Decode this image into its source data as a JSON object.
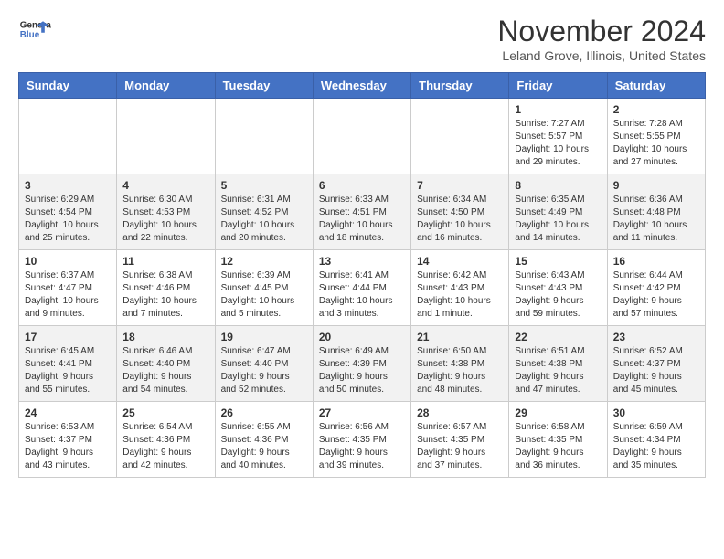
{
  "header": {
    "logo_line1": "General",
    "logo_line2": "Blue",
    "month_title": "November 2024",
    "location": "Leland Grove, Illinois, United States"
  },
  "days_of_week": [
    "Sunday",
    "Monday",
    "Tuesday",
    "Wednesday",
    "Thursday",
    "Friday",
    "Saturday"
  ],
  "weeks": [
    [
      {
        "day": "",
        "info": ""
      },
      {
        "day": "",
        "info": ""
      },
      {
        "day": "",
        "info": ""
      },
      {
        "day": "",
        "info": ""
      },
      {
        "day": "",
        "info": ""
      },
      {
        "day": "1",
        "info": "Sunrise: 7:27 AM\nSunset: 5:57 PM\nDaylight: 10 hours and 29 minutes."
      },
      {
        "day": "2",
        "info": "Sunrise: 7:28 AM\nSunset: 5:55 PM\nDaylight: 10 hours and 27 minutes."
      }
    ],
    [
      {
        "day": "3",
        "info": "Sunrise: 6:29 AM\nSunset: 4:54 PM\nDaylight: 10 hours and 25 minutes."
      },
      {
        "day": "4",
        "info": "Sunrise: 6:30 AM\nSunset: 4:53 PM\nDaylight: 10 hours and 22 minutes."
      },
      {
        "day": "5",
        "info": "Sunrise: 6:31 AM\nSunset: 4:52 PM\nDaylight: 10 hours and 20 minutes."
      },
      {
        "day": "6",
        "info": "Sunrise: 6:33 AM\nSunset: 4:51 PM\nDaylight: 10 hours and 18 minutes."
      },
      {
        "day": "7",
        "info": "Sunrise: 6:34 AM\nSunset: 4:50 PM\nDaylight: 10 hours and 16 minutes."
      },
      {
        "day": "8",
        "info": "Sunrise: 6:35 AM\nSunset: 4:49 PM\nDaylight: 10 hours and 14 minutes."
      },
      {
        "day": "9",
        "info": "Sunrise: 6:36 AM\nSunset: 4:48 PM\nDaylight: 10 hours and 11 minutes."
      }
    ],
    [
      {
        "day": "10",
        "info": "Sunrise: 6:37 AM\nSunset: 4:47 PM\nDaylight: 10 hours and 9 minutes."
      },
      {
        "day": "11",
        "info": "Sunrise: 6:38 AM\nSunset: 4:46 PM\nDaylight: 10 hours and 7 minutes."
      },
      {
        "day": "12",
        "info": "Sunrise: 6:39 AM\nSunset: 4:45 PM\nDaylight: 10 hours and 5 minutes."
      },
      {
        "day": "13",
        "info": "Sunrise: 6:41 AM\nSunset: 4:44 PM\nDaylight: 10 hours and 3 minutes."
      },
      {
        "day": "14",
        "info": "Sunrise: 6:42 AM\nSunset: 4:43 PM\nDaylight: 10 hours and 1 minute."
      },
      {
        "day": "15",
        "info": "Sunrise: 6:43 AM\nSunset: 4:43 PM\nDaylight: 9 hours and 59 minutes."
      },
      {
        "day": "16",
        "info": "Sunrise: 6:44 AM\nSunset: 4:42 PM\nDaylight: 9 hours and 57 minutes."
      }
    ],
    [
      {
        "day": "17",
        "info": "Sunrise: 6:45 AM\nSunset: 4:41 PM\nDaylight: 9 hours and 55 minutes."
      },
      {
        "day": "18",
        "info": "Sunrise: 6:46 AM\nSunset: 4:40 PM\nDaylight: 9 hours and 54 minutes."
      },
      {
        "day": "19",
        "info": "Sunrise: 6:47 AM\nSunset: 4:40 PM\nDaylight: 9 hours and 52 minutes."
      },
      {
        "day": "20",
        "info": "Sunrise: 6:49 AM\nSunset: 4:39 PM\nDaylight: 9 hours and 50 minutes."
      },
      {
        "day": "21",
        "info": "Sunrise: 6:50 AM\nSunset: 4:38 PM\nDaylight: 9 hours and 48 minutes."
      },
      {
        "day": "22",
        "info": "Sunrise: 6:51 AM\nSunset: 4:38 PM\nDaylight: 9 hours and 47 minutes."
      },
      {
        "day": "23",
        "info": "Sunrise: 6:52 AM\nSunset: 4:37 PM\nDaylight: 9 hours and 45 minutes."
      }
    ],
    [
      {
        "day": "24",
        "info": "Sunrise: 6:53 AM\nSunset: 4:37 PM\nDaylight: 9 hours and 43 minutes."
      },
      {
        "day": "25",
        "info": "Sunrise: 6:54 AM\nSunset: 4:36 PM\nDaylight: 9 hours and 42 minutes."
      },
      {
        "day": "26",
        "info": "Sunrise: 6:55 AM\nSunset: 4:36 PM\nDaylight: 9 hours and 40 minutes."
      },
      {
        "day": "27",
        "info": "Sunrise: 6:56 AM\nSunset: 4:35 PM\nDaylight: 9 hours and 39 minutes."
      },
      {
        "day": "28",
        "info": "Sunrise: 6:57 AM\nSunset: 4:35 PM\nDaylight: 9 hours and 37 minutes."
      },
      {
        "day": "29",
        "info": "Sunrise: 6:58 AM\nSunset: 4:35 PM\nDaylight: 9 hours and 36 minutes."
      },
      {
        "day": "30",
        "info": "Sunrise: 6:59 AM\nSunset: 4:34 PM\nDaylight: 9 hours and 35 minutes."
      }
    ]
  ]
}
